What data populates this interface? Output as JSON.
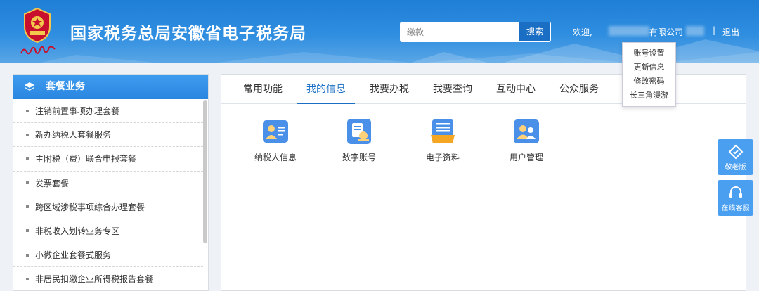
{
  "header": {
    "title": "国家税务总局安徽省电子税务局",
    "search": {
      "placeholder": "缴款",
      "button": "搜索"
    },
    "welcome": "欢迎,",
    "company_suffix": "有限公司",
    "separator": "|",
    "logout": "退出"
  },
  "dropdown": {
    "items": [
      "账号设置",
      "更新信息",
      "修改密码",
      "长三角漫游"
    ]
  },
  "sidebar": {
    "title": "套餐业务",
    "items": [
      "注销前置事项办理套餐",
      "新办纳税人套餐服务",
      "主附税（费）联合申报套餐",
      "发票套餐",
      "跨区域涉税事项综合办理套餐",
      "非税收入划转业务专区",
      "小微企业套餐式服务",
      "非居民扣缴企业所得税报告套餐"
    ]
  },
  "main": {
    "tabs": [
      "常用功能",
      "我的信息",
      "我要办税",
      "我要查询",
      "互动中心",
      "公众服务"
    ],
    "active_tab": "我的信息",
    "functions": [
      {
        "label": "纳税人信息",
        "icon": "taxpayer-info-icon"
      },
      {
        "label": "数字账号",
        "icon": "digital-account-icon"
      },
      {
        "label": "电子资料",
        "icon": "electronic-documents-icon"
      },
      {
        "label": "用户管理",
        "icon": "user-management-icon"
      }
    ]
  },
  "floating": {
    "elderly": "敬老版",
    "service": "在线客服"
  },
  "colors": {
    "header_blue": "#2f8ee0",
    "accent": "#1a6fc4",
    "sidebar_head": "#3e9cf0",
    "float_btn": "#4a9ff0"
  }
}
